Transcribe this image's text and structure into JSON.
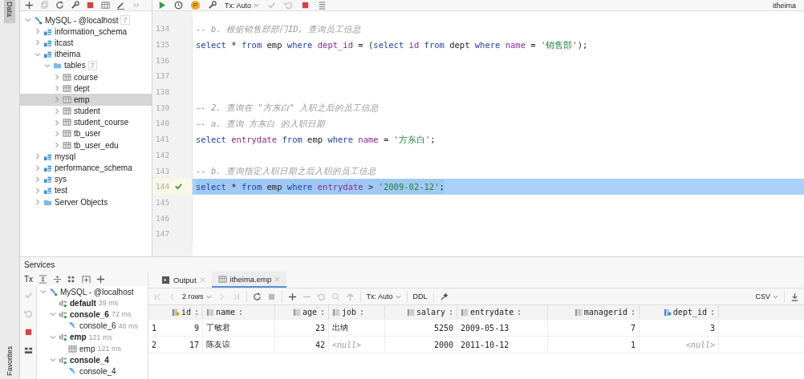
{
  "side_strip": {
    "top_tab": "Data",
    "bottom_tab": "Favorites"
  },
  "db_panel": {
    "toolbar": [
      {
        "kind": "add"
      },
      {
        "kind": "copy"
      },
      {
        "kind": "refresh"
      },
      {
        "kind": "wrench"
      },
      {
        "kind": "stop"
      },
      {
        "kind": "table"
      },
      {
        "kind": "pencil"
      },
      {
        "kind": "more"
      }
    ],
    "tree": [
      {
        "kind": "connection",
        "label": "MySQL - @localhost",
        "count": "7",
        "expanded": true,
        "selected": false,
        "children": [
          {
            "kind": "schema",
            "label": "information_schema",
            "expanded": false,
            "selected": false
          },
          {
            "kind": "schema",
            "label": "itcast",
            "expanded": false,
            "selected": false
          },
          {
            "kind": "schema",
            "label": "itheima",
            "expanded": true,
            "selected": false,
            "children": [
              {
                "kind": "folder",
                "label": "tables",
                "count": "7",
                "expanded": true,
                "selected": false,
                "children": [
                  {
                    "kind": "table",
                    "label": "course",
                    "expanded": false,
                    "selected": false
                  },
                  {
                    "kind": "table",
                    "label": "dept",
                    "expanded": false,
                    "selected": false
                  },
                  {
                    "kind": "table",
                    "label": "emp",
                    "expanded": false,
                    "selected": true
                  },
                  {
                    "kind": "table",
                    "label": "student",
                    "expanded": false,
                    "selected": false
                  },
                  {
                    "kind": "table",
                    "label": "student_course",
                    "expanded": false,
                    "selected": false
                  },
                  {
                    "kind": "table",
                    "label": "tb_user",
                    "expanded": false,
                    "selected": false
                  },
                  {
                    "kind": "table",
                    "label": "tb_user_edu",
                    "expanded": false,
                    "selected": false
                  }
                ]
              }
            ]
          },
          {
            "kind": "schema",
            "label": "mysql",
            "expanded": false,
            "selected": false
          },
          {
            "kind": "schema",
            "label": "performance_schema",
            "expanded": false,
            "selected": false
          },
          {
            "kind": "schema",
            "label": "sys",
            "expanded": false,
            "selected": false
          },
          {
            "kind": "schema",
            "label": "test",
            "expanded": false,
            "selected": false
          },
          {
            "kind": "objects",
            "label": "Server Objects",
            "expanded": false,
            "selected": false
          }
        ]
      }
    ]
  },
  "editor_toolbar": [
    {
      "kind": "run"
    },
    {
      "kind": "history"
    },
    {
      "kind": "badge",
      "text": "P"
    },
    {
      "kind": "wrench"
    },
    {
      "kind": "dropdown",
      "text": "Tx: Auto"
    },
    {
      "kind": "commit"
    },
    {
      "kind": "rollback"
    },
    {
      "kind": "stop"
    },
    {
      "kind": "list"
    }
  ],
  "user": {
    "label": "itheima"
  },
  "editor": {
    "lines": [
      {
        "number": "134",
        "selected": false,
        "executed": false,
        "kind": "comment",
        "text": "-- b. 根据销售部部门ID, 查询员工信息"
      },
      {
        "number": "135",
        "selected": false,
        "executed": false,
        "kind": "code",
        "tokens": [
          {
            "kind": "keyword",
            "text": "select "
          },
          {
            "kind": "plain",
            "text": "* "
          },
          {
            "kind": "keyword",
            "text": "from "
          },
          {
            "kind": "plain",
            "text": "emp "
          },
          {
            "kind": "keyword",
            "text": "where "
          },
          {
            "kind": "column",
            "text": "dept_id"
          },
          {
            "kind": "plain",
            "text": " = ("
          },
          {
            "kind": "keyword",
            "text": "select "
          },
          {
            "kind": "column",
            "text": "id "
          },
          {
            "kind": "keyword",
            "text": "from "
          },
          {
            "kind": "plain",
            "text": "dept "
          },
          {
            "kind": "keyword",
            "text": "where "
          },
          {
            "kind": "column",
            "text": "name"
          },
          {
            "kind": "plain",
            "text": " = "
          },
          {
            "kind": "string",
            "text": "'销售部'"
          },
          {
            "kind": "plain",
            "text": ");"
          }
        ]
      },
      {
        "number": "136",
        "selected": false,
        "executed": false
      },
      {
        "number": "137",
        "selected": false,
        "executed": false
      },
      {
        "number": "138",
        "selected": false,
        "executed": false
      },
      {
        "number": "139",
        "selected": false,
        "executed": false,
        "kind": "comment",
        "text": "-- 2. 查询在 \"方东白\" 入职之后的员工信息"
      },
      {
        "number": "140",
        "selected": false,
        "executed": false,
        "kind": "comment",
        "text": "-- a. 查询 方东白 的入职日期"
      },
      {
        "number": "141",
        "selected": false,
        "executed": false,
        "kind": "code",
        "tokens": [
          {
            "kind": "keyword",
            "text": "select "
          },
          {
            "kind": "column",
            "text": "entrydate "
          },
          {
            "kind": "keyword",
            "text": "from "
          },
          {
            "kind": "plain",
            "text": "emp "
          },
          {
            "kind": "keyword",
            "text": "where "
          },
          {
            "kind": "column",
            "text": "name"
          },
          {
            "kind": "plain",
            "text": " = "
          },
          {
            "kind": "string",
            "text": "'方东白'"
          },
          {
            "kind": "plain",
            "text": ";"
          }
        ]
      },
      {
        "number": "142",
        "selected": false,
        "executed": false
      },
      {
        "number": "143",
        "selected": false,
        "executed": false,
        "kind": "comment",
        "text": "-- b. 查询指定入职日期之后入职的员工信息"
      },
      {
        "number": "144",
        "selected": true,
        "executed": true,
        "kind": "code",
        "tokens": [
          {
            "kind": "keyword",
            "text": "select "
          },
          {
            "kind": "plain",
            "text": "* "
          },
          {
            "kind": "keyword",
            "text": "from "
          },
          {
            "kind": "plain",
            "text": "emp "
          },
          {
            "kind": "keyword",
            "text": "where "
          },
          {
            "kind": "column",
            "text": "entrydate"
          },
          {
            "kind": "plain",
            "text": " > "
          },
          {
            "kind": "string",
            "text": "'2009-02-12'"
          },
          {
            "kind": "plain",
            "text": ";"
          }
        ]
      },
      {
        "number": "145",
        "selected": false,
        "executed": false
      },
      {
        "number": "146",
        "selected": false,
        "executed": false
      },
      {
        "number": "147",
        "selected": false,
        "executed": false
      }
    ]
  },
  "services": {
    "title": "Services",
    "toolbar": [
      {
        "kind": "tx",
        "text": "Tx"
      },
      {
        "kind": "expand-all"
      },
      {
        "kind": "collapse-all"
      },
      {
        "kind": "group"
      },
      {
        "kind": "new-tab"
      },
      {
        "kind": "add"
      }
    ],
    "side_tools": [
      {
        "kind": "commit"
      },
      {
        "kind": "rollback"
      },
      {
        "kind": "stop"
      },
      {
        "kind": "layout"
      }
    ],
    "tree": [
      {
        "kind": "connection",
        "label": "MySQL - @localhost",
        "expanded": true,
        "children": [
          {
            "kind": "session",
            "label": "default",
            "time": "39 ms"
          },
          {
            "kind": "session",
            "label": "console_6",
            "time": "72 ms",
            "expanded": true,
            "children": [
              {
                "kind": "console",
                "label": "console_6",
                "time": "40 ms"
              }
            ]
          },
          {
            "kind": "session",
            "label": "emp",
            "time": "121 ms",
            "expanded": true,
            "children": [
              {
                "kind": "table",
                "label": "emp",
                "time": "121 ms"
              }
            ]
          },
          {
            "kind": "session",
            "label": "console_4",
            "expanded": true,
            "children": [
              {
                "kind": "console",
                "label": "console_4"
              }
            ]
          }
        ]
      }
    ]
  },
  "results": {
    "tabs": [
      {
        "kind": "output",
        "label": "Output",
        "selected": false
      },
      {
        "kind": "table",
        "label": "itheima.emp",
        "selected": true
      }
    ],
    "toolbar": {
      "rows_label": "2 rows",
      "tx_label": "Tx: Auto",
      "ddl_label": "DDL",
      "export_label": "CSV"
    },
    "columns": [
      {
        "name": "id",
        "kind": "primary",
        "numeric": true
      },
      {
        "name": "name",
        "kind": "plain",
        "numeric": false
      },
      {
        "name": "age",
        "kind": "plain",
        "numeric": true
      },
      {
        "name": "job",
        "kind": "plain",
        "numeric": false
      },
      {
        "name": "salary",
        "kind": "plain",
        "numeric": true
      },
      {
        "name": "entrydate",
        "kind": "plain",
        "numeric": false
      },
      {
        "name": "managerid",
        "kind": "plain",
        "numeric": true
      },
      {
        "name": "dept_id",
        "kind": "foreign",
        "numeric": true
      }
    ],
    "rows": [
      {
        "number": "1",
        "cells": [
          {
            "value": "9",
            "null": false
          },
          {
            "value": "丁敏君",
            "null": false
          },
          {
            "value": "23",
            "null": false
          },
          {
            "value": "出纳",
            "null": false
          },
          {
            "value": "5250",
            "null": false
          },
          {
            "value": "2009-05-13",
            "null": false
          },
          {
            "value": "7",
            "null": false
          },
          {
            "value": "3",
            "null": false
          }
        ]
      },
      {
        "number": "2",
        "cells": [
          {
            "value": "17",
            "null": false
          },
          {
            "value": "陈友谅",
            "null": false
          },
          {
            "value": "42",
            "null": false
          },
          {
            "value": "<null>",
            "null": true
          },
          {
            "value": "2000",
            "null": false
          },
          {
            "value": "2011-10-12",
            "null": false
          },
          {
            "value": "1",
            "null": false
          },
          {
            "value": "<null>",
            "null": true
          }
        ]
      }
    ]
  }
}
